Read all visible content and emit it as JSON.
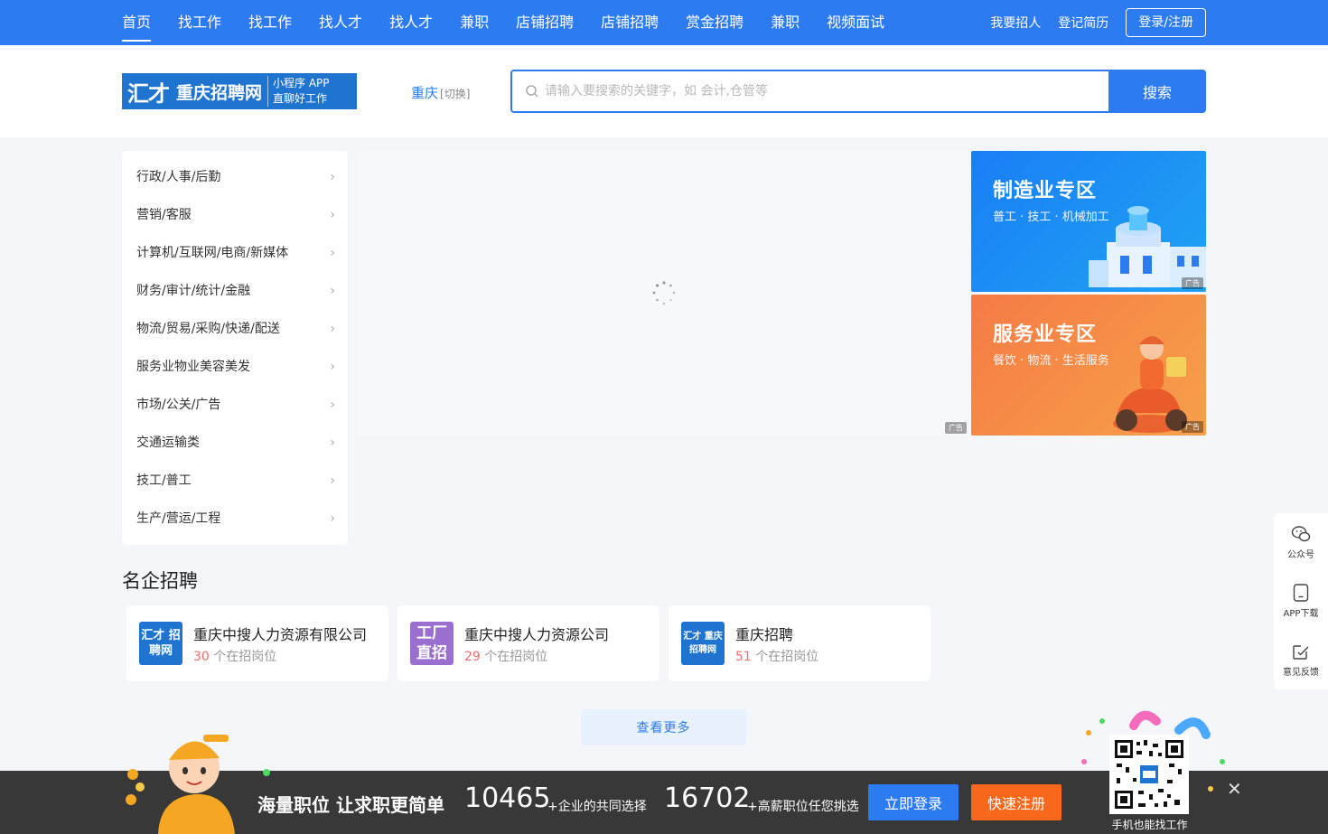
{
  "nav": {
    "items": [
      {
        "label": "首页",
        "active": true
      },
      {
        "label": "找工作"
      },
      {
        "label": "找工作"
      },
      {
        "label": "找人才"
      },
      {
        "label": "找人才"
      },
      {
        "label": "兼职"
      },
      {
        "label": "店铺招聘"
      },
      {
        "label": "店铺招聘"
      },
      {
        "label": "赏金招聘"
      },
      {
        "label": "兼职"
      },
      {
        "label": "视频面试"
      }
    ],
    "recruit_link": "我要招人",
    "resume_link": "登记简历",
    "login_button": "登录/注册"
  },
  "header": {
    "logo_mark": "汇才",
    "logo_name": "重庆招聘网",
    "logo_sub_top": "小程序 APP",
    "logo_sub_bottom": "直聊好工作",
    "city": "重庆",
    "city_switch": "[切换]",
    "search_placeholder": "请输入要搜索的关键字，如 会计,仓管等",
    "search_button": "搜索"
  },
  "categories": [
    "行政/人事/后勤",
    "营销/客服",
    "计算机/互联网/电商/新媒体",
    "财务/审计/统计/金融",
    "物流/贸易/采购/快递/配送",
    "服务业物业美容美发",
    "市场/公关/广告",
    "交通运输类",
    "技工/普工",
    "生产/营运/工程"
  ],
  "ad_tag": "广告",
  "banners": [
    {
      "title": "制造业专区",
      "subtitle": "普工 · 技工 · 机械加工"
    },
    {
      "title": "服务业专区",
      "subtitle": "餐饮 · 物流 · 生活服务"
    }
  ],
  "famous": {
    "title": "名企招聘",
    "count_suffix": "个在招岗位",
    "companies": [
      {
        "name": "重庆中搜人力资源有限公司",
        "count": "30",
        "logo_text": "汇才 招聘网",
        "logo_color": "#1f74cf"
      },
      {
        "name": "重庆中搜人力资源公司",
        "count": "29",
        "logo_text": "工厂 直招",
        "logo_color": "#9b6fcf"
      },
      {
        "name": "重庆招聘",
        "count": "51",
        "logo_text": "汇才 重庆招聘网",
        "logo_color": "#1f74cf"
      }
    ],
    "more_button": "查看更多"
  },
  "side_tools": [
    {
      "label": "公众号",
      "icon": "wechat-icon"
    },
    {
      "label": "APP下载",
      "icon": "phone-icon"
    },
    {
      "label": "意见反馈",
      "icon": "feedback-icon"
    }
  ],
  "bottom_bar": {
    "slogan": "海量职位 让求职更简单",
    "stat1_num": "10465",
    "stat1_desc": "+企业的共同选择",
    "stat2_num": "16702",
    "stat2_desc": "+高薪职位任您挑选",
    "login_button": "立即登录",
    "register_button": "快速注册",
    "qr_caption": "手机也能找工作"
  },
  "colors": {
    "primary": "#2d7bf0",
    "orange": "#f7681c",
    "count_red": "#f56c6c"
  }
}
